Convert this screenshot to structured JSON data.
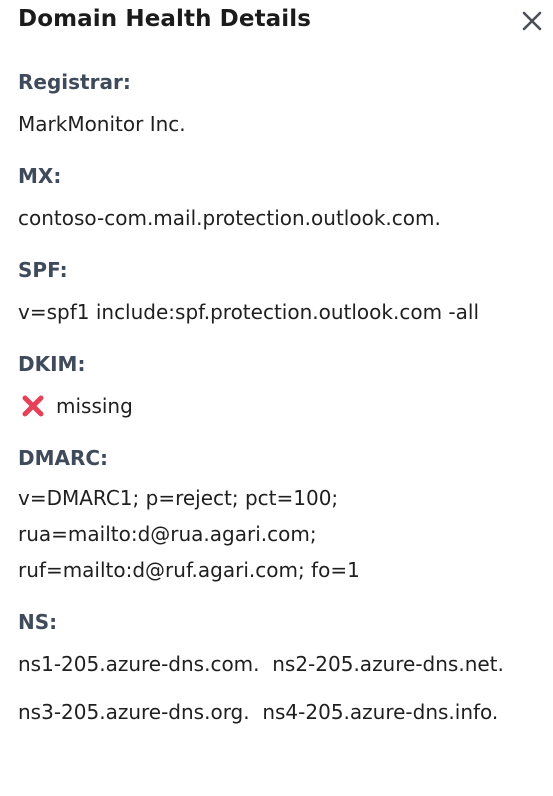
{
  "panel": {
    "title": "Domain Health Details",
    "close_icon": "close-icon"
  },
  "fields": {
    "registrar": {
      "label": "Registrar:",
      "value": "MarkMonitor Inc."
    },
    "mx": {
      "label": "MX:",
      "value": "contoso-com.mail.protection.outlook.com."
    },
    "spf": {
      "label": "SPF:",
      "value": "v=spf1 include:spf.protection.outlook.com -all"
    },
    "dkim": {
      "label": "DKIM:",
      "status_icon": "cross-mark-icon",
      "value": "missing"
    },
    "dmarc": {
      "label": "DMARC:",
      "lines": [
        "v=DMARC1; p=reject; pct=100;",
        "rua=mailto:d@rua.agari.com;",
        "ruf=mailto:d@ruf.agari.com; fo=1"
      ]
    },
    "ns": {
      "label": "NS:",
      "lines": [
        "ns1-205.azure-dns.com.  ns2-205.azure-dns.net.",
        "ns3-205.azure-dns.org.  ns4-205.azure-dns.info."
      ]
    }
  },
  "colors": {
    "label": "#3f4a5a",
    "text": "#1f1f1f",
    "error_icon": "#e5425a"
  }
}
